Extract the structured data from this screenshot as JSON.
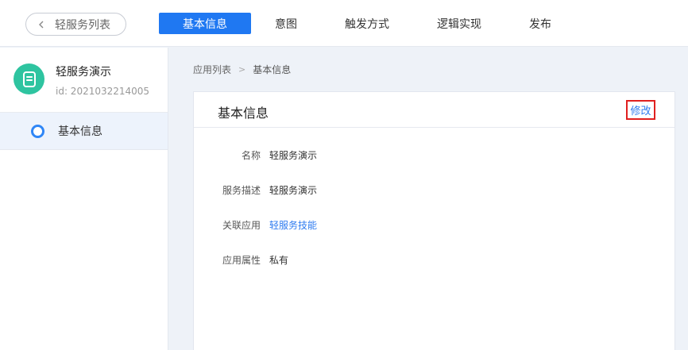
{
  "topbar": {
    "back_label": "轻服务列表",
    "tabs": [
      {
        "label": "基本信息",
        "active": true
      },
      {
        "label": "意图",
        "active": false
      },
      {
        "label": "触发方式",
        "active": false
      },
      {
        "label": "逻辑实现",
        "active": false
      },
      {
        "label": "发布",
        "active": false
      }
    ]
  },
  "sidebar": {
    "app_name": "轻服务演示",
    "app_id": "id: 2021032214005",
    "items": [
      {
        "label": "基本信息",
        "active": true
      }
    ]
  },
  "breadcrumb": {
    "root": "应用列表",
    "separator": ">",
    "current": "基本信息"
  },
  "panel": {
    "title": "基本信息",
    "edit_label": "修改",
    "fields": [
      {
        "key": "名称",
        "value": "轻服务演示",
        "is_link": false
      },
      {
        "key": "服务描述",
        "value": "轻服务演示",
        "is_link": false
      },
      {
        "key": "关联应用",
        "value": "轻服务技能",
        "is_link": true
      },
      {
        "key": "应用属性",
        "value": "私有",
        "is_link": false
      }
    ]
  },
  "colors": {
    "accent": "#1f78f2",
    "highlight_border": "#e02020",
    "app_icon_bg": "#2ec4a0"
  }
}
